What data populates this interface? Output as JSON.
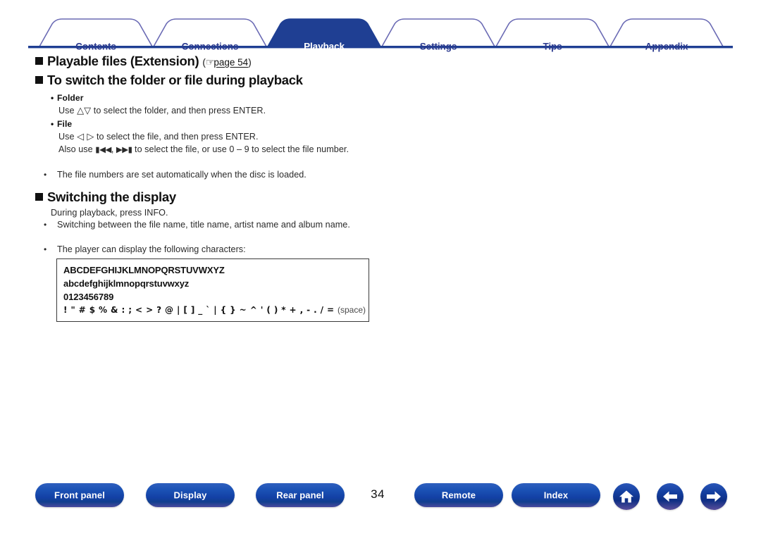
{
  "tabs": {
    "items": [
      {
        "label": "Contents",
        "active": false
      },
      {
        "label": "Connections",
        "active": false
      },
      {
        "label": "Playback",
        "active": true
      },
      {
        "label": "Settings",
        "active": false
      },
      {
        "label": "Tips",
        "active": false
      },
      {
        "label": "Appendix",
        "active": false
      }
    ],
    "active_color": "#1f3f93",
    "inactive_text_color": "#2b3a8f",
    "outline_color": "#6a6ab4",
    "rule_color": "#1f3f93"
  },
  "headings": {
    "playable_files": "Playable files (Extension)",
    "playable_files_ref_open": "(",
    "playable_files_ref_hand": "☞",
    "playable_files_ref_page": "page 54",
    "playable_files_ref_close": ")",
    "switch_folder_file": "To switch the folder or file during playback",
    "switching_display": "Switching the display"
  },
  "folder_section": {
    "label": "Folder",
    "instruction_pre": "Use ",
    "instruction_glyph": "△▽",
    "instruction_post": " to select the folder, and then press ENTER."
  },
  "file_section": {
    "label": "File",
    "line1_pre": "Use ",
    "line1_glyph": "◁ ▷",
    "line1_post": " to select the file, and then press ENTER.",
    "line2_pre": "Also use ",
    "line2_glyph1": "◀◀",
    "line2_mid": ", ",
    "line2_glyph2": "▶▶",
    "line2_post": " to select the file, or use 0 – 9 to select the file number."
  },
  "notes": {
    "bullet_file_numbers": "The file numbers are set automatically when the disc is loaded."
  },
  "display_section": {
    "intro": "During playback, press INFO.",
    "bullet1": "Switching between the file name, title name, artist name and album name.",
    "bullet2": "The player can display the following characters:"
  },
  "char_box": {
    "uppercase": "ABCDEFGHIJKLMNOPQRSTUVWXYZ",
    "lowercase": "abcdefghijklmnopqrstuvwxyz",
    "digits": "0123456789",
    "symbols": "! \" # $ % & : ; < > ? @ | [ ] _ ` | { } ~ ^ ' ( ) * + , - . / =",
    "space_label": "(space)"
  },
  "footer": {
    "buttons": [
      {
        "label": "Front panel",
        "name": "front-panel"
      },
      {
        "label": "Display",
        "name": "display"
      },
      {
        "label": "Rear panel",
        "name": "rear-panel"
      },
      {
        "label": "Remote",
        "name": "remote"
      },
      {
        "label": "Index",
        "name": "index"
      }
    ],
    "page_number": "34",
    "icons": [
      {
        "name": "home-icon"
      },
      {
        "name": "arrow-left-icon"
      },
      {
        "name": "arrow-right-icon"
      }
    ],
    "pill_color": "#1340a5",
    "circle_color": "#143f9f"
  }
}
